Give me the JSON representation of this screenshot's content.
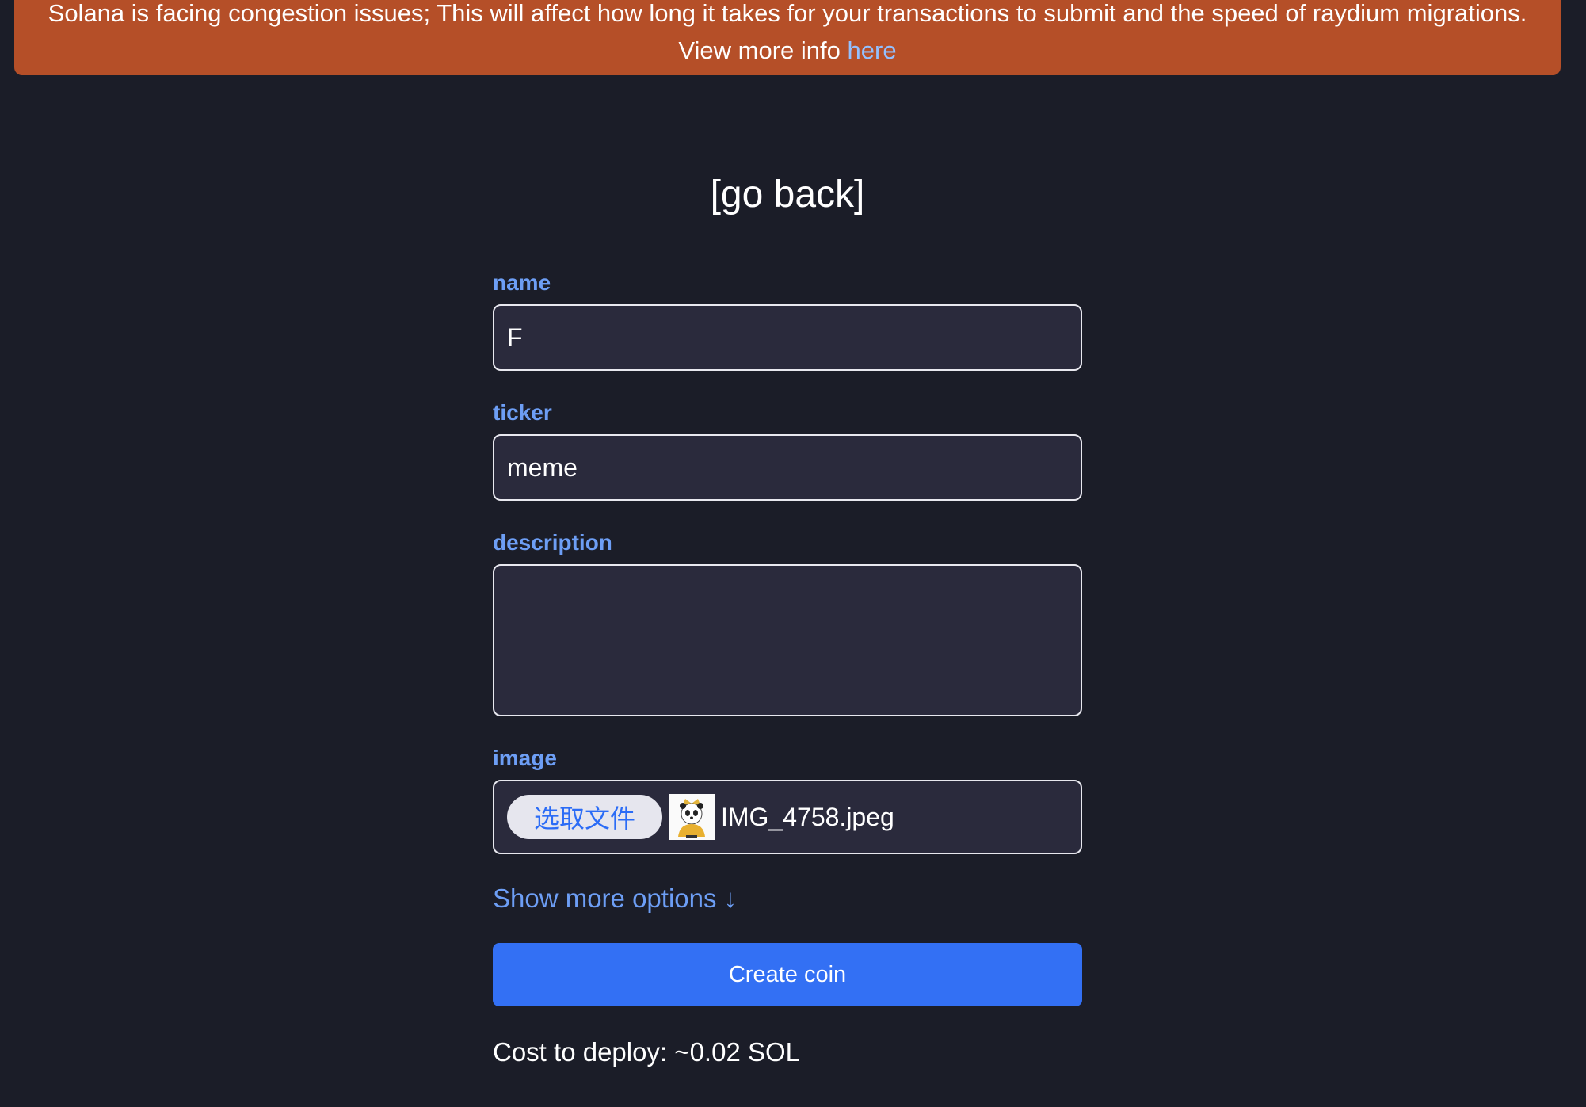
{
  "banner": {
    "message": "Solana is facing congestion issues; This will affect how long it takes for your transactions to submit and the speed of raydium migrations. View more info ",
    "link_label": "here"
  },
  "header": {
    "go_back_label": "[go back]"
  },
  "form": {
    "name": {
      "label": "name",
      "value": "F"
    },
    "ticker": {
      "label": "ticker",
      "value": "meme"
    },
    "description": {
      "label": "description",
      "value": ""
    },
    "image": {
      "label": "image",
      "choose_file_label": "选取文件",
      "file_name": "IMG_4758.jpeg"
    },
    "show_more_label": "Show more options ↓",
    "create_button_label": "Create coin",
    "cost_text": "Cost to deploy: ~0.02 SOL"
  },
  "colors": {
    "background": "#1b1d28",
    "banner": "#b54f28",
    "accent": "#3370f4",
    "label": "#6d9ef5"
  }
}
